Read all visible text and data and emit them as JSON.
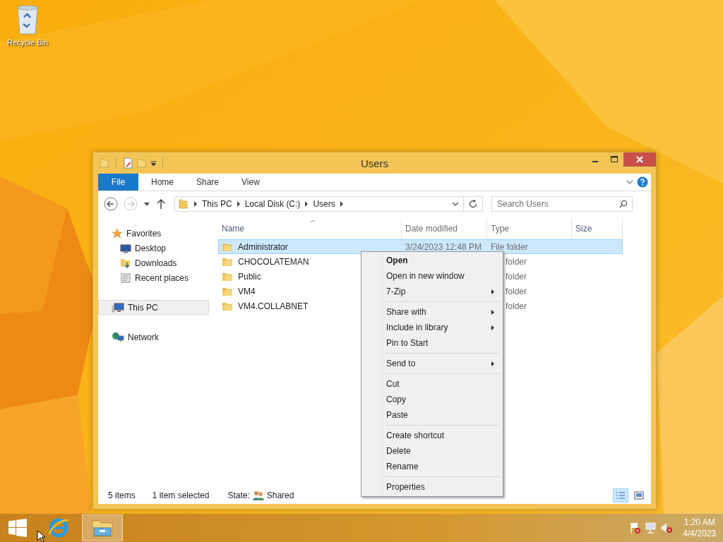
{
  "desktop": {
    "icons": [
      {
        "label": "Recycle Bin",
        "kind": "recycle"
      }
    ]
  },
  "window": {
    "title": "Users"
  },
  "ribbon": {
    "tabs": [
      {
        "label": "File",
        "kind": "file",
        "selected": false
      },
      {
        "label": "Home",
        "kind": "tab",
        "selected": false
      },
      {
        "label": "Share",
        "kind": "tab",
        "selected": false
      },
      {
        "label": "View",
        "kind": "tab",
        "selected": false
      }
    ]
  },
  "address": {
    "crumbs": [
      "This PC",
      "Local Disk (C:)",
      "Users"
    ]
  },
  "search": {
    "placeholder": "Search Users"
  },
  "navigation": [
    {
      "label": "Favorites",
      "kind": "star",
      "selected": false,
      "children": [
        {
          "label": "Desktop",
          "kind": "desktop",
          "selected": false
        },
        {
          "label": "Downloads",
          "kind": "downloads",
          "selected": false
        },
        {
          "label": "Recent places",
          "kind": "recent",
          "selected": false
        }
      ]
    },
    {
      "label": "This PC",
      "kind": "pc",
      "selected": true
    },
    {
      "label": "Network",
      "kind": "network",
      "selected": false
    }
  ],
  "columns": [
    {
      "label": "Name",
      "sorted": true
    },
    {
      "label": "Date modified",
      "sorted": false
    },
    {
      "label": "Type",
      "sorted": false
    },
    {
      "label": "Size",
      "sorted": false
    }
  ],
  "rows": [
    {
      "name": "Administrator",
      "date": "3/24/2023 12:48 PM",
      "type": "File folder",
      "selected": true
    },
    {
      "name": "CHOCOLATEMAN",
      "type": "folder",
      "selected": false
    },
    {
      "name": "Public",
      "type": "folder",
      "selected": false
    },
    {
      "name": "VM4",
      "type": "folder",
      "selected": false
    },
    {
      "name": "VM4.COLLABNET",
      "type": "folder",
      "selected": false
    }
  ],
  "context_menu": {
    "groups": [
      [
        {
          "label": "Open",
          "bold": true,
          "submenu": false
        },
        {
          "label": "Open in new window",
          "bold": false,
          "submenu": false
        },
        {
          "label": "7-Zip",
          "bold": false,
          "submenu": true
        }
      ],
      [
        {
          "label": "Share with",
          "bold": false,
          "submenu": true
        },
        {
          "label": "Include in library",
          "bold": false,
          "submenu": true
        },
        {
          "label": "Pin to Start",
          "bold": false,
          "submenu": false
        }
      ],
      [
        {
          "label": "Send to",
          "bold": false,
          "submenu": true
        }
      ],
      [
        {
          "label": "Cut",
          "bold": false,
          "submenu": false
        },
        {
          "label": "Copy",
          "bold": false,
          "submenu": false
        },
        {
          "label": "Paste",
          "bold": false,
          "submenu": false
        }
      ],
      [
        {
          "label": "Create shortcut",
          "bold": false,
          "submenu": false
        },
        {
          "label": "Delete",
          "bold": false,
          "submenu": false
        },
        {
          "label": "Rename",
          "bold": false,
          "submenu": false
        }
      ],
      [
        {
          "label": "Properties",
          "bold": false,
          "submenu": false
        }
      ]
    ]
  },
  "status_bar": {
    "count": "5 items",
    "selection": "1 item selected",
    "state_label": "State:",
    "state_value": "Shared",
    "views": [
      {
        "kind": "details",
        "selected": true
      },
      {
        "kind": "tiles",
        "selected": false
      }
    ]
  },
  "taskbar": {
    "apps": [
      {
        "kind": "browser",
        "selected": false
      },
      {
        "kind": "explorer",
        "selected": true
      }
    ],
    "clock": {
      "time": "1:20 AM",
      "date": "4/4/2023"
    }
  }
}
